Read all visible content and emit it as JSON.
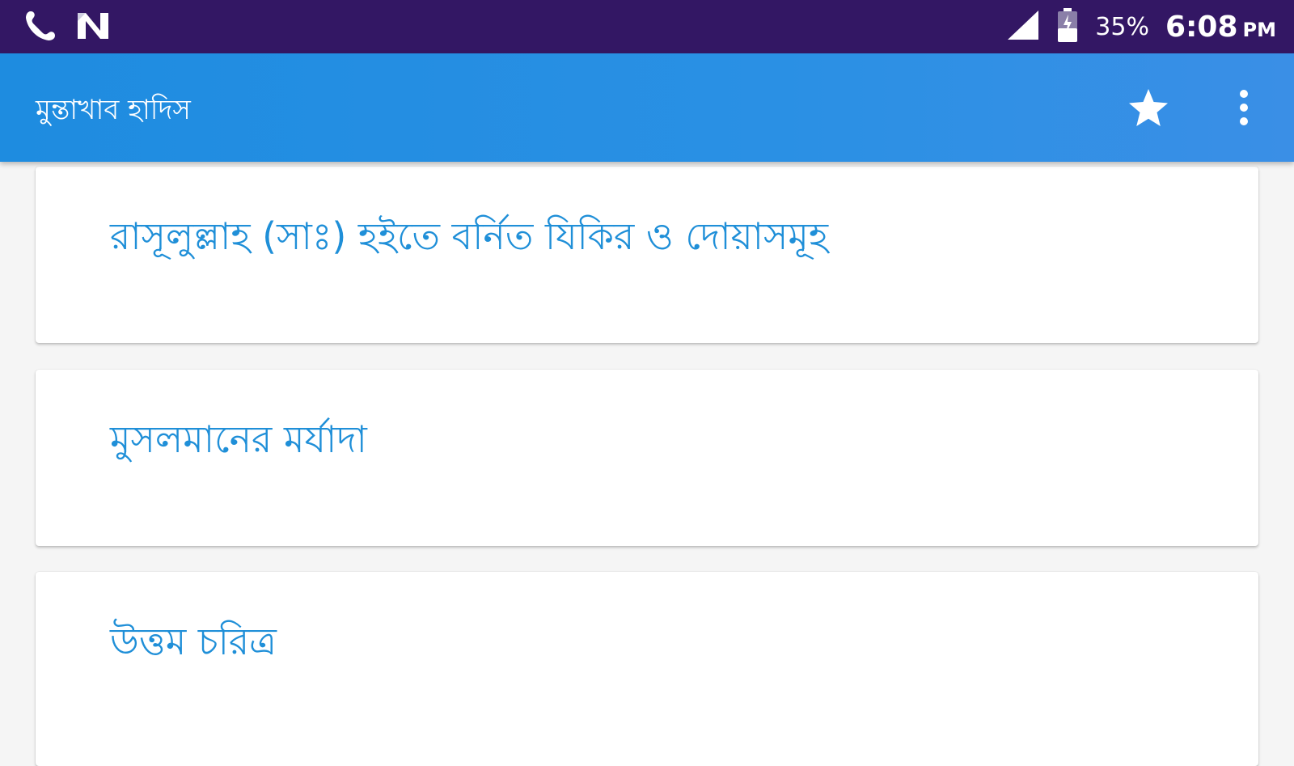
{
  "status_bar": {
    "icons_left": [
      "phone-icon",
      "n-notification-icon"
    ],
    "icons_right": [
      "signal-icon",
      "battery-icon"
    ],
    "battery_percent": "35%",
    "time": "6:08",
    "am_pm": "PM"
  },
  "app_bar": {
    "title": "মুন্তাখাব হাদিস",
    "actions": [
      "star-icon",
      "more-vert-icon"
    ]
  },
  "chapters": [
    {
      "title": "রাসূলুল্লাহ (সাঃ) হইতে বর্নিত যিকির ও দোয়াসমূহ"
    },
    {
      "title": "মুসলমানের মর্যাদা"
    },
    {
      "title": "উত্তম চরিত্র"
    }
  ],
  "colors": {
    "status_bar": "#331764",
    "app_bar": "#2a90e4",
    "item_text": "#1f8fd8",
    "background": "#f5f5f5"
  }
}
